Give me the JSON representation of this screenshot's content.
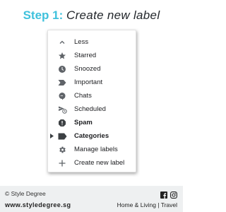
{
  "title": {
    "step": "Step 1:",
    "label": "Create new label"
  },
  "menu": {
    "items": [
      {
        "label": "Less",
        "icon": "chevron-up-icon",
        "bold": false
      },
      {
        "label": "Starred",
        "icon": "star-icon",
        "bold": false
      },
      {
        "label": "Snoozed",
        "icon": "clock-icon",
        "bold": false
      },
      {
        "label": "Important",
        "icon": "important-icon",
        "bold": false
      },
      {
        "label": "Chats",
        "icon": "chat-icon",
        "bold": false
      },
      {
        "label": "Scheduled",
        "icon": "scheduled-send-icon",
        "bold": false
      },
      {
        "label": "Spam",
        "icon": "spam-icon",
        "bold": true
      },
      {
        "label": "Categories",
        "icon": "label-icon",
        "bold": true,
        "expandable": true
      },
      {
        "label": "Manage labels",
        "icon": "gear-icon",
        "bold": false
      },
      {
        "label": "Create new label",
        "icon": "plus-icon",
        "bold": false
      }
    ]
  },
  "footer": {
    "copyright": "© Style Degree",
    "url": "www.styledegree.sg",
    "categories": "Home & Living  | Travel",
    "social_icons": [
      "facebook-icon",
      "instagram-icon"
    ]
  },
  "colors": {
    "accent": "#3fc1dc",
    "icon": "#5f6368",
    "footer_bg": "#eef0f1"
  }
}
